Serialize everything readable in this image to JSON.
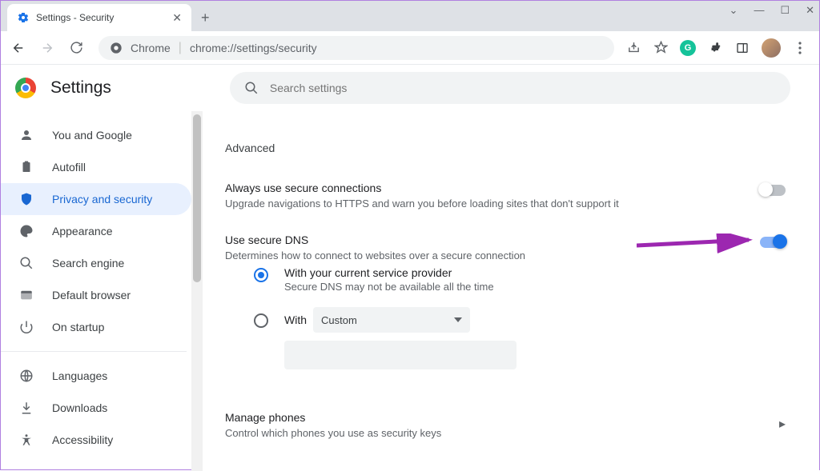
{
  "window": {
    "tab_title": "Settings - Security"
  },
  "addr": {
    "prefix": "Chrome",
    "url": "chrome://settings/security"
  },
  "header": {
    "title": "Settings",
    "search_placeholder": "Search settings"
  },
  "sidebar": {
    "items": [
      {
        "label": "You and Google"
      },
      {
        "label": "Autofill"
      },
      {
        "label": "Privacy and security"
      },
      {
        "label": "Appearance"
      },
      {
        "label": "Search engine"
      },
      {
        "label": "Default browser"
      },
      {
        "label": "On startup"
      },
      {
        "label": "Languages"
      },
      {
        "label": "Downloads"
      },
      {
        "label": "Accessibility"
      }
    ]
  },
  "content": {
    "section_label": "Advanced",
    "secure_conn": {
      "title": "Always use secure connections",
      "desc": "Upgrade navigations to HTTPS and warn you before loading sites that don't support it"
    },
    "secure_dns": {
      "title": "Use secure DNS",
      "desc": "Determines how to connect to websites over a secure connection",
      "opt1_title": "With your current service provider",
      "opt1_desc": "Secure DNS may not be available all the time",
      "opt2_label": "With",
      "custom_value": "Custom"
    },
    "manage_phones": {
      "title": "Manage phones",
      "desc": "Control which phones you use as security keys"
    }
  }
}
